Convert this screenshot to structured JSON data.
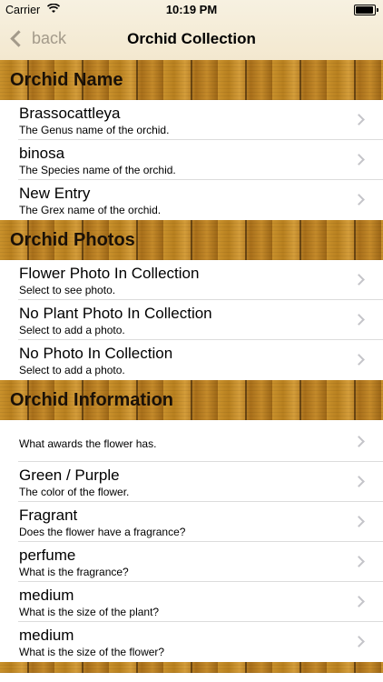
{
  "status_bar": {
    "carrier": "Carrier",
    "wifi_icon": "wifi-icon",
    "time": "10:19 PM",
    "battery_icon": "battery-icon"
  },
  "nav": {
    "back_label": "back",
    "back_icon": "chevron-left-icon",
    "title": "Orchid Collection"
  },
  "sections": [
    {
      "title": "Orchid Name",
      "rows": [
        {
          "title": "Brassocattleya",
          "subtitle": "The Genus name of the orchid."
        },
        {
          "title": "binosa",
          "subtitle": "The Species name of the orchid."
        },
        {
          "title": "New Entry",
          "subtitle": "The Grex name of the orchid."
        }
      ]
    },
    {
      "title": "Orchid Photos",
      "rows": [
        {
          "title": "Flower Photo In Collection",
          "subtitle": "Select to see photo."
        },
        {
          "title": "No Plant Photo In Collection",
          "subtitle": "Select to add a photo."
        },
        {
          "title": "No Photo In Collection",
          "subtitle": "Select to add a photo."
        }
      ]
    },
    {
      "title": "Orchid Information",
      "rows": [
        {
          "title": "",
          "subtitle": "What awards the flower has."
        },
        {
          "title": "Green / Purple",
          "subtitle": "The color of the flower."
        },
        {
          "title": "Fragrant",
          "subtitle": "Does the flower have a fragrance?"
        },
        {
          "title": "perfume",
          "subtitle": "What is the fragrance?"
        },
        {
          "title": "medium",
          "subtitle": "What is the size of the plant?"
        },
        {
          "title": "medium",
          "subtitle": "What is the size of the flower?"
        }
      ]
    }
  ],
  "colors": {
    "nav_bg": "#f5edd8",
    "back_tint": "#a39a8a",
    "wood": "#b57c1f",
    "chevron": "#c4c4c9"
  }
}
